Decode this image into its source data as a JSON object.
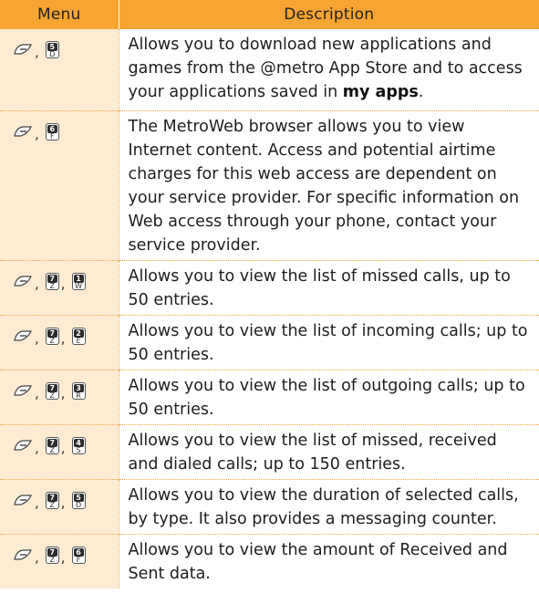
{
  "table": {
    "header": {
      "menu": "Menu",
      "description": "Description"
    },
    "rows": [
      {
        "keys": [
          {
            "digit": "5",
            "letter": "D"
          }
        ],
        "description": "Allows you to download new applications and games from the @metro App Store and to access your applications saved in ",
        "description_bold": "my apps",
        "description_tail": "."
      },
      {
        "keys": [
          {
            "digit": "6",
            "letter": "F"
          }
        ],
        "description": "The MetroWeb browser allows you to view Internet content. Access and potential airtime charges for this web access are dependent on your service provider. For specific information on Web access through your phone, contact your service provider."
      },
      {
        "keys": [
          {
            "digit": "7",
            "letter": "Z"
          },
          {
            "digit": "1",
            "letter": "W"
          }
        ],
        "description": "Allows you to view the list of missed calls, up to 50 entries."
      },
      {
        "keys": [
          {
            "digit": "7",
            "letter": "Z"
          },
          {
            "digit": "2",
            "letter": "E"
          }
        ],
        "description": "Allows you to view the list of incoming calls; up to 50 entries."
      },
      {
        "keys": [
          {
            "digit": "7",
            "letter": "Z"
          },
          {
            "digit": "3",
            "letter": "R"
          }
        ],
        "description": "Allows you to view the list of outgoing calls; up to 50 entries."
      },
      {
        "keys": [
          {
            "digit": "7",
            "letter": "Z"
          },
          {
            "digit": "4",
            "letter": "S"
          }
        ],
        "description": "Allows you to view the list of missed, received and dialed calls; up to 150 entries."
      },
      {
        "keys": [
          {
            "digit": "7",
            "letter": "Z"
          },
          {
            "digit": "5",
            "letter": "D"
          }
        ],
        "description": "Allows you to view the duration of selected calls, by type. It also provides a messaging counter."
      },
      {
        "keys": [
          {
            "digit": "7",
            "letter": "Z"
          },
          {
            "digit": "6",
            "letter": "F"
          }
        ],
        "description": "Allows you to view the amount of Received and Sent data."
      }
    ],
    "separator": ",",
    "soft_key_icon": "left-soft-key-icon",
    "colors": {
      "header_bg": "#f7a532",
      "key_cell_bg": "#fdecd2",
      "divider": "#f1a33c"
    }
  }
}
